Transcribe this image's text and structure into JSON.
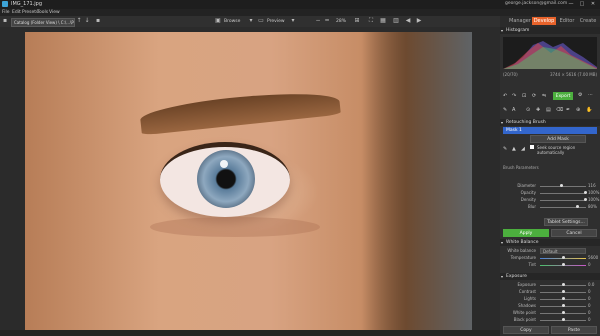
{
  "window": {
    "title": "IMG_171.jpg",
    "email": "george.jackson@gmail.com",
    "minimize": "—",
    "maximize": "□",
    "close": "✕"
  },
  "menu": [
    "File",
    "Edit",
    "Presets",
    "Tools",
    "View"
  ],
  "modes": [
    "Manager",
    "Develop",
    "Editor",
    "Create"
  ],
  "active_mode": "Develop",
  "toolbar": {
    "breadcrumb": "Catalog (Folder View) \\ C:\\...\\Pictures\\",
    "browse": "Browse",
    "preview": "Preview",
    "zoom": "28%"
  },
  "panel": {
    "histogram_title": "Histogram",
    "histo_left": "(20/70)",
    "histo_right": "3744 × 5616 (7.00 MB)",
    "export_label": "Export",
    "retouch_title": "Retouching Brush",
    "mask_label": "Mask 1",
    "add_mask": "Add Mask",
    "seek_label": "Seek source region automatically",
    "brush_params": "Brush Parameters",
    "params": [
      {
        "label": "Diameter",
        "value": "116"
      },
      {
        "label": "Opacity",
        "value": "100%"
      },
      {
        "label": "Density",
        "value": "100%"
      },
      {
        "label": "Blur",
        "value": "80%"
      }
    ],
    "tablet_settings": "Tablet Settings...",
    "apply": "Apply",
    "cancel": "Cancel",
    "wb_title": "White Balance",
    "wb_label": "White balance",
    "wb_value": "Default",
    "temperature": {
      "label": "Temperature",
      "value": "5600"
    },
    "tint": {
      "label": "Tint",
      "value": "0"
    },
    "exposure_title": "Exposure",
    "exposure_rows": [
      {
        "label": "Exposure",
        "value": "0.0"
      },
      {
        "label": "Contrast",
        "value": "0"
      },
      {
        "label": "Lights",
        "value": "0"
      },
      {
        "label": "Shadows",
        "value": "0"
      },
      {
        "label": "White point",
        "value": "0"
      },
      {
        "label": "Black point",
        "value": "0"
      }
    ],
    "copy": "Copy",
    "paste": "Paste"
  }
}
